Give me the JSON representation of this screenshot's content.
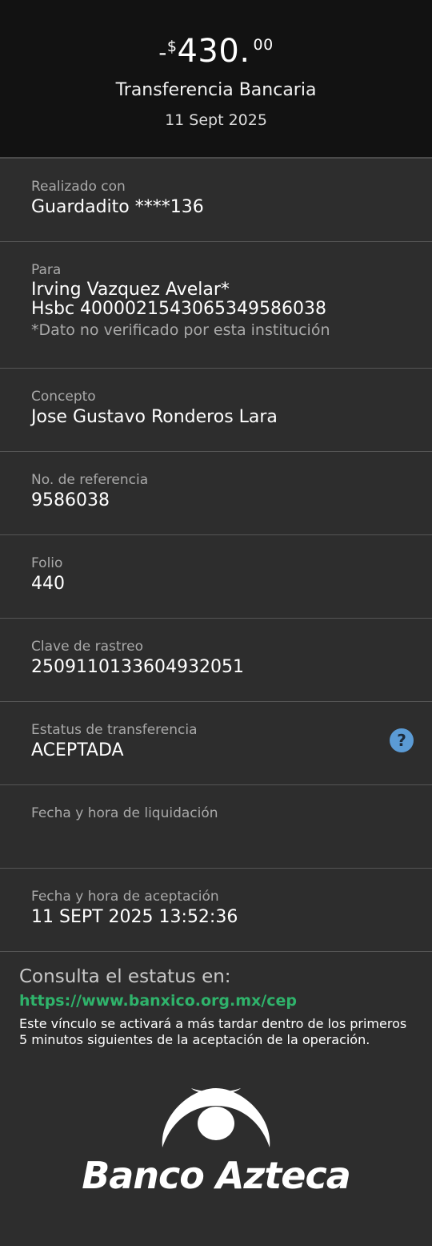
{
  "header": {
    "amount_sign": "-",
    "amount_currency": "$",
    "amount_integer": "430.",
    "amount_cents": "00",
    "title": "Transferencia Bancaria",
    "date": "11 Sept 2025"
  },
  "details": {
    "realizado": {
      "label": "Realizado con",
      "value": "Guardadito ****136"
    },
    "para": {
      "label": "Para",
      "name": "Irving Vazquez Avelar*",
      "account": "Hsbc 4000021543065349586038",
      "note": "*Dato no verificado por esta institución"
    },
    "concepto": {
      "label": "Concepto",
      "value": "Jose Gustavo Ronderos Lara"
    },
    "referencia": {
      "label": "No. de referencia",
      "value": "9586038"
    },
    "folio": {
      "label": "Folio",
      "value": "440"
    },
    "rastreo": {
      "label": "Clave de rastreo",
      "value": "2509110133604932051"
    },
    "estatus": {
      "label": "Estatus de transferencia",
      "value": "ACEPTADA",
      "help_icon": "?"
    },
    "liquidacion": {
      "label": "Fecha y hora de liquidación",
      "value": ""
    },
    "aceptacion": {
      "label": "Fecha y hora de aceptación",
      "value": "11 SEPT 2025 13:52:36"
    }
  },
  "footer": {
    "consulta": "Consulta el estatus en:",
    "link": "https://www.banxico.org.mx/cep",
    "note": "Este vínculo se activará a más tardar dentro de los primeros 5 minutos siguientes de la aceptación de la operación.",
    "brand": "Banco Azteca",
    "link_color": "#2fb36b",
    "help_color": "#5b9bd5"
  }
}
